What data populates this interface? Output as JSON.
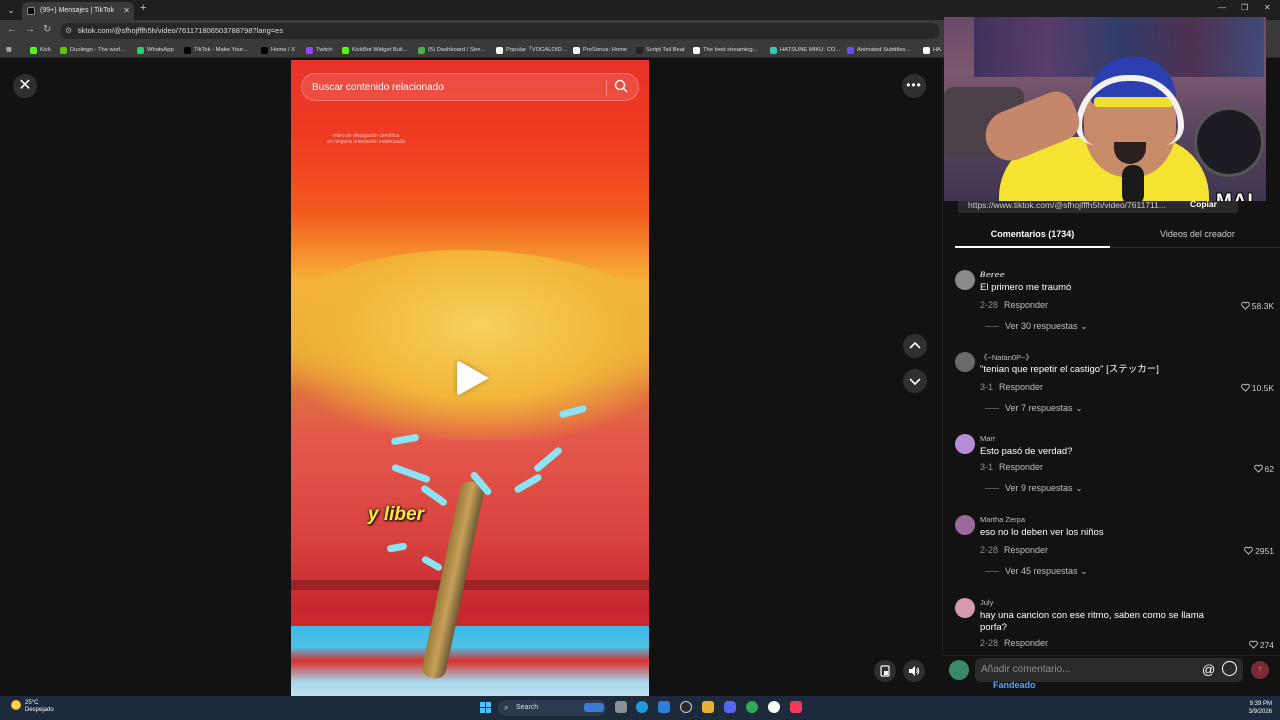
{
  "browser": {
    "tab_title": "(99+) Mensajes | TikTok",
    "url": "tiktok.com/@sfhojfffh5h/video/761171806503788798?lang=es",
    "bookmarks": [
      {
        "label": "Kick",
        "color": "#53fc18"
      },
      {
        "label": "Duolingo - The worl...",
        "color": "#58cc02"
      },
      {
        "label": "WhatsApp",
        "color": "#25d366"
      },
      {
        "label": "TikTok - Make Your...",
        "color": "#000000"
      },
      {
        "label": "Home / X",
        "color": "#000000"
      },
      {
        "label": "Twitch",
        "color": "#9146ff"
      },
      {
        "label": "KickBot Widget Buil...",
        "color": "#53fc18"
      },
      {
        "label": "(5) Dashboard / Stre...",
        "color": "#4caf50"
      },
      {
        "label": "Popular「VOCALOID...",
        "color": "#ffffff"
      },
      {
        "label": "PreSonus: Home",
        "color": "#ffffff"
      },
      {
        "label": "Script Tail Beat",
        "color": "#222222"
      },
      {
        "label": "The best streaming...",
        "color": "#ffffff"
      },
      {
        "label": "HATSUNE MIKU: CO...",
        "color": "#39c5bb"
      },
      {
        "label": "Animated Subtitles...",
        "color": "#6a4cff"
      },
      {
        "label": "HA",
        "color": "#ffffff"
      }
    ]
  },
  "video": {
    "search_placeholder": "Buscar contenido relacionado",
    "note_line1": "video de divulgación científica",
    "note_line2": "en ninguna orientación inadecuada",
    "caption": "y liber"
  },
  "panel": {
    "share_link": "https://www.tiktok.com/@sfhojfffh5h/video/7611711...",
    "copy_label": "Copiar",
    "tab_comments": "Comentarios (1734)",
    "tab_videos": "Videos del creador"
  },
  "comments": [
    {
      "user": "𝘽𝙚𝙧𝙚𝙚",
      "text": "El primero me traumó",
      "date": "2-28",
      "reply": "Responder",
      "likes": "58.3K",
      "replies": "Ver 30 respuestas",
      "avatar": "#8a8a8a"
    },
    {
      "user": "《~Natan0P~》",
      "text": "\"tenian que repetir el castigo\" [ステッカー]",
      "date": "3-1",
      "reply": "Responder",
      "likes": "10.5K",
      "replies": "Ver 7 respuestas",
      "avatar": "#6a6a6a"
    },
    {
      "user": "Marr",
      "text": "Esto pasó de verdad?",
      "date": "3-1",
      "reply": "Responder",
      "likes": "62",
      "replies": "Ver 9 respuestas",
      "avatar": "#b98cd6"
    },
    {
      "user": "Martha Zerpa",
      "text": "eso no lo deben ver los niños",
      "date": "2-28",
      "reply": "Responder",
      "likes": "2951",
      "replies": "Ver 45 respuestas",
      "avatar": "#9b6a9a"
    },
    {
      "user": "July",
      "text": "hay una cancion con ese ritmo, saben como se llama porfa?",
      "date": "2-28",
      "reply": "Responder",
      "likes": "274",
      "replies": "",
      "avatar": "#d69ab0"
    }
  ],
  "compose": {
    "placeholder": "Añadir comentario...",
    "fandeado": "Fandeado"
  },
  "webcam": {
    "logo": "MAI"
  },
  "taskbar": {
    "temp": "25°C",
    "weather": "Despejado",
    "search": "Search",
    "time": "9:39 PM",
    "date": "3/9/2026"
  }
}
